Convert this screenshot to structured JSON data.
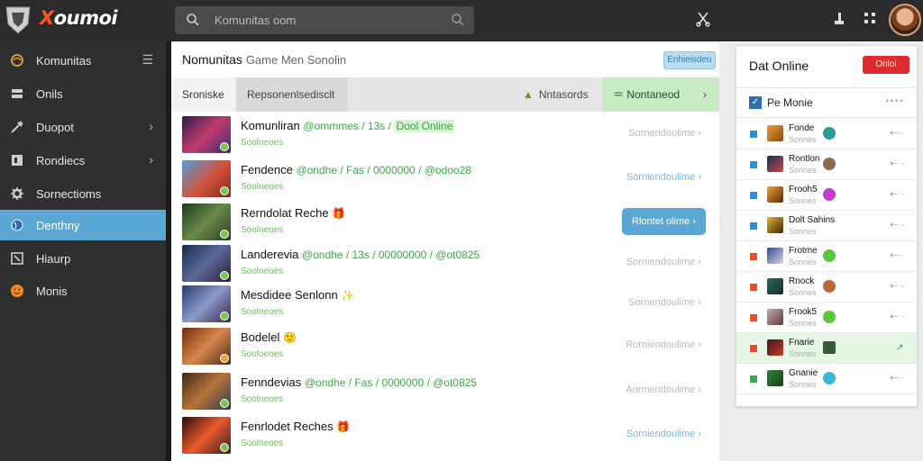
{
  "app": {
    "logo_text": "oumoi",
    "logo_x": "X",
    "search_placeholder": "Komunitas oom"
  },
  "sidebar": {
    "items": [
      {
        "label": "Komunitas",
        "icon": "swirl-icon",
        "chev": "☰"
      },
      {
        "label": "Onils",
        "icon": "layers-icon",
        "chev": ""
      },
      {
        "label": "Duopot",
        "icon": "tools-icon",
        "chev": "›"
      },
      {
        "label": "Rondiecs",
        "icon": "panel-icon",
        "chev": "›"
      },
      {
        "label": "Sornectioms",
        "icon": "gear-icon",
        "chev": ""
      },
      {
        "label": "Denthny",
        "icon": "globe-icon",
        "chev": ""
      },
      {
        "label": "Hiaurp",
        "icon": "edit-icon",
        "chev": ""
      },
      {
        "label": "Monis",
        "icon": "face-icon",
        "chev": ""
      }
    ]
  },
  "panel": {
    "title": "Nomunitas",
    "subtitle": "Game Men Sonolin",
    "top_button": "Enhieisdeu",
    "tabs": {
      "t1": "Sroniske",
      "t2": "Repsonenlsedisclt",
      "t3": "Nntasords",
      "t4": "Nontaneod"
    },
    "rows": [
      {
        "title": "Komunliran",
        "meta": "@ommmes / 13s /",
        "tag": "Dool Online",
        "status": "Soolneoes",
        "action": "Sornendoulime",
        "action_style": "grey"
      },
      {
        "title": "Fendence",
        "meta": "@ondhe / Fas / 0000000 / @odoo28",
        "tag": "",
        "status": "Soolneoes",
        "action": "Sorniendoulime",
        "action_style": "blue"
      },
      {
        "title": "Rerndolat Reche",
        "meta": "",
        "tag": "",
        "emoji": "🎁",
        "status": "Soolneoes",
        "action": "Rlontet olime",
        "action_style": "big"
      },
      {
        "title": "Landerevia",
        "meta": "@ondhe / 13s / 00000000 / @ot0825",
        "tag": "",
        "status": "Soolneoes",
        "action": "Sorniendoulime",
        "action_style": "grey"
      },
      {
        "title": "Mesdidee Senlonn",
        "meta": "",
        "tag": "",
        "emoji": "✨",
        "status": "Soolneoes",
        "action": "Sornendoulime",
        "action_style": "grey"
      },
      {
        "title": "Bodelel",
        "meta": "",
        "tag": "",
        "emoji": "🙂",
        "status": "Sooloeoes",
        "action": "Rorniendoulime",
        "action_style": "grey"
      },
      {
        "title": "Fenndevias",
        "meta": "@ondhe / Fas / 0000000 / @ot0825",
        "tag": "",
        "status": "Soolneoes",
        "action": "Aormendoulime",
        "action_style": "grey"
      },
      {
        "title": "Fenrlodet Reches",
        "meta": "",
        "tag": "",
        "emoji": "🎁",
        "status": "Soolneoes",
        "action": "Sorniendoulime",
        "action_style": "blue"
      }
    ]
  },
  "online": {
    "title": "Dat Online",
    "button": "Onloi",
    "head_label": "Pe Monie",
    "head_dots": "••••",
    "users": [
      {
        "name": "Fonde",
        "status": "Sonnes"
      },
      {
        "name": "Rontlon",
        "status": "Sonnes"
      },
      {
        "name": "Frooh5",
        "status": "Sonnes"
      },
      {
        "name": "Dolt Sahins",
        "status": "Sonnes"
      },
      {
        "name": "Frotme",
        "status": "Sonnes"
      },
      {
        "name": "Rnock",
        "status": "Sonnes"
      },
      {
        "name": "Frook5",
        "status": "Sonnes"
      },
      {
        "name": "Fnarie",
        "status": "Sonnes"
      },
      {
        "name": "Gnanie",
        "status": "Sonnes"
      }
    ]
  },
  "colors": {
    "accent": "#5aa7d4",
    "online_green": "#3aa84a",
    "danger": "#dd2c2c"
  }
}
